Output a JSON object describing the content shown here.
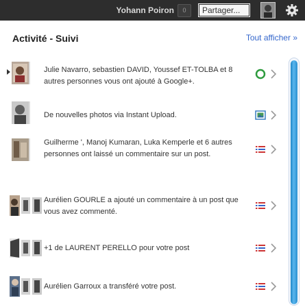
{
  "topbar": {
    "user_name": "Yohann Poiron",
    "notification_count": "0",
    "share_label": "Partager..."
  },
  "panel": {
    "title": "Activité - Suivi",
    "show_all": "Tout afficher »"
  },
  "notifications": [
    {
      "text": "Julie Navarro, sebastien DAVID, Youssef ET-TOLBA et 8 autres personnes vous ont ajouté à Google+.",
      "icon": "circle-add-icon",
      "thumb": "avatar-stack"
    },
    {
      "text": "De nouvelles photos via Instant Upload.",
      "icon": "photo-icon",
      "thumb": "avatar"
    },
    {
      "text": "Guilherme ', Manoj Kumaran, Luka Kemperle et 6 autres personnes ont laissé un commentaire sur un post.",
      "icon": "comment-list-icon",
      "thumb": "avatar-stack"
    },
    {
      "text": "Aurélien GOURLE a ajouté un commentaire à un post que vous avez commenté.",
      "icon": "comment-list-icon",
      "thumb": "avatars"
    },
    {
      "text": "+1 de LAURENT PERELLO pour votre post",
      "icon": "comment-list-icon",
      "thumb": "avatars"
    },
    {
      "text": "Aurélien Garroux a transféré votre post.",
      "icon": "comment-list-icon",
      "thumb": "avatars"
    }
  ],
  "colors": {
    "topbar_bg": "#2d2d2d",
    "link": "#3366cc",
    "scroll_thumb": "#2a8fd0",
    "circle_icon": "#2e9b3e",
    "list_icon": "#cc3333"
  }
}
